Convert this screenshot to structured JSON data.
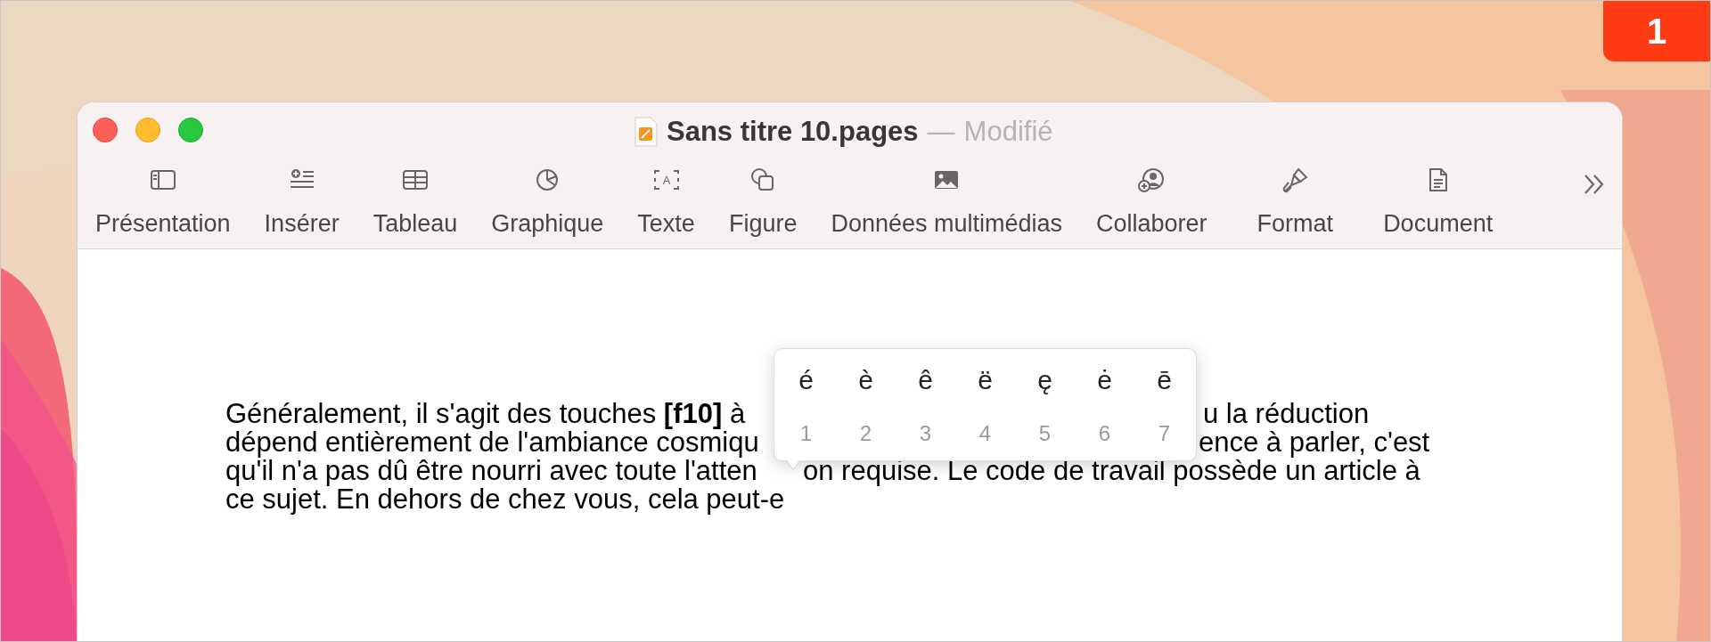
{
  "badge": "1",
  "window": {
    "title": "Sans titre 10.pages",
    "separator": "—",
    "status": "Modifié"
  },
  "toolbar": [
    {
      "label": "Présentation"
    },
    {
      "label": "Insérer"
    },
    {
      "label": "Tableau"
    },
    {
      "label": "Graphique"
    },
    {
      "label": "Texte",
      "icon_text": "A"
    },
    {
      "label": "Figure"
    },
    {
      "label": "Données multimédias"
    },
    {
      "label": "Collaborer"
    },
    {
      "label": "Format"
    },
    {
      "label": "Document"
    }
  ],
  "document": {
    "lines": [
      {
        "segments": [
          "Généralement, il s'agit des touches **[f10]** à",
          "u la réduction"
        ]
      },
      {
        "segments": [
          "dépend entièrement de l'ambiance cosmiqu",
          "ence à parler, c'est"
        ]
      },
      {
        "segments": [
          "qu'il n'a pas dû être nourri avec toute l'atten",
          "on requise. Le code de travail possède un article à"
        ]
      },
      {
        "segments": [
          "ce sujet. En dehors de chez vous, cela peut-e"
        ]
      }
    ]
  },
  "accent_popup": {
    "options": [
      {
        "char": "é",
        "key": "1"
      },
      {
        "char": "è",
        "key": "2"
      },
      {
        "char": "ê",
        "key": "3"
      },
      {
        "char": "ë",
        "key": "4"
      },
      {
        "char": "ę",
        "key": "5"
      },
      {
        "char": "ė",
        "key": "6"
      },
      {
        "char": "ē",
        "key": "7"
      }
    ]
  }
}
